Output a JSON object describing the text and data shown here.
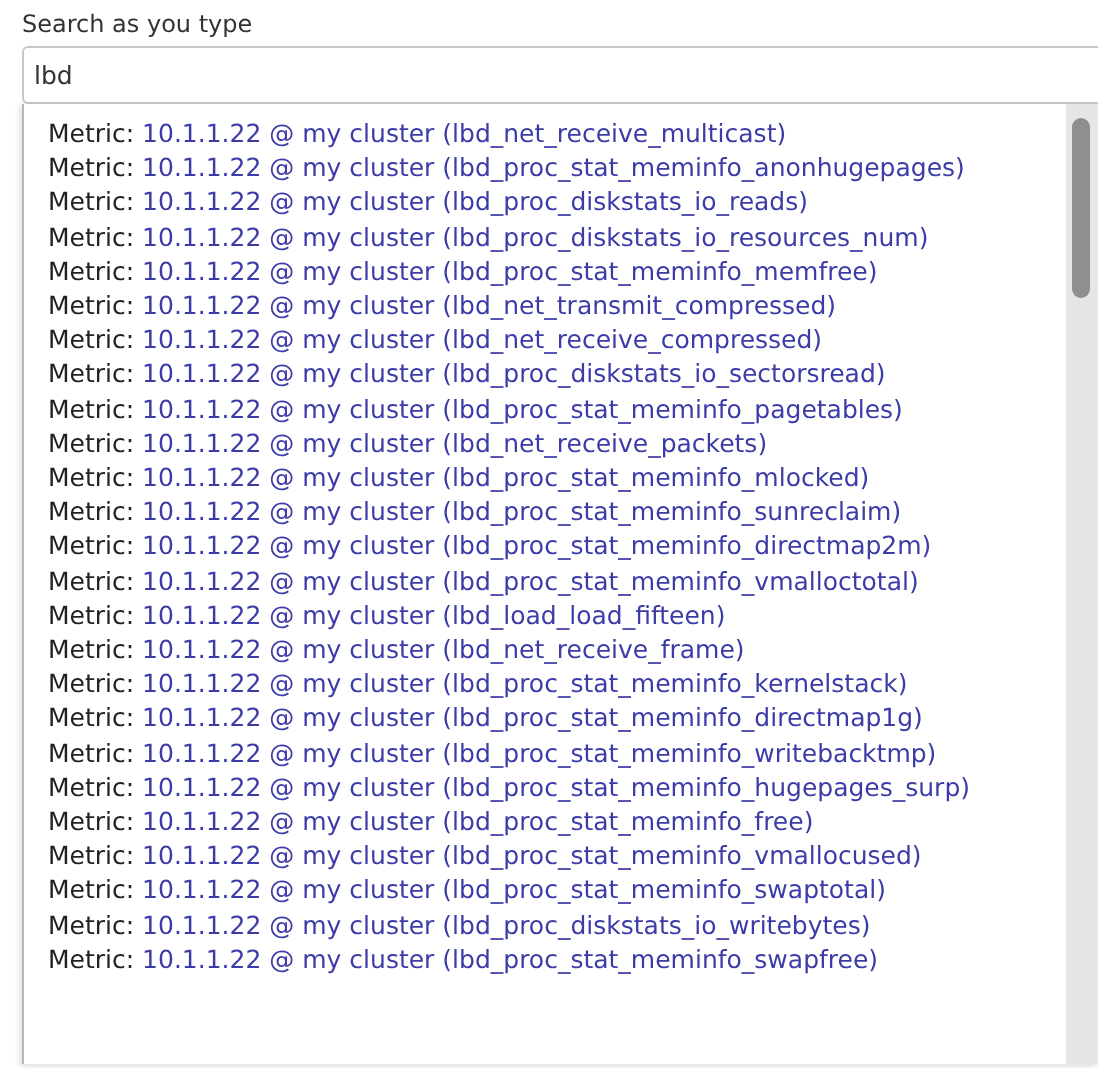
{
  "search": {
    "label": "Search as you type",
    "value": "lbd"
  },
  "suggestions": [
    {
      "label": "Metric:",
      "value": "10.1.1.22 @ my cluster (lbd_net_receive_multicast)"
    },
    {
      "label": "Metric:",
      "value": "10.1.1.22 @ my cluster (lbd_proc_stat_meminfo_anonhugepages)"
    },
    {
      "label": "Metric:",
      "value": "10.1.1.22 @ my cluster (lbd_proc_diskstats_io_reads)"
    },
    {
      "label": "Metric:",
      "value": "10.1.1.22 @ my cluster (lbd_proc_diskstats_io_resources_num)"
    },
    {
      "label": "Metric:",
      "value": "10.1.1.22 @ my cluster (lbd_proc_stat_meminfo_memfree)"
    },
    {
      "label": "Metric:",
      "value": "10.1.1.22 @ my cluster (lbd_net_transmit_compressed)"
    },
    {
      "label": "Metric:",
      "value": "10.1.1.22 @ my cluster (lbd_net_receive_compressed)"
    },
    {
      "label": "Metric:",
      "value": "10.1.1.22 @ my cluster (lbd_proc_diskstats_io_sectorsread)"
    },
    {
      "label": "Metric:",
      "value": "10.1.1.22 @ my cluster (lbd_proc_stat_meminfo_pagetables)"
    },
    {
      "label": "Metric:",
      "value": "10.1.1.22 @ my cluster (lbd_net_receive_packets)"
    },
    {
      "label": "Metric:",
      "value": "10.1.1.22 @ my cluster (lbd_proc_stat_meminfo_mlocked)"
    },
    {
      "label": "Metric:",
      "value": "10.1.1.22 @ my cluster (lbd_proc_stat_meminfo_sunreclaim)"
    },
    {
      "label": "Metric:",
      "value": "10.1.1.22 @ my cluster (lbd_proc_stat_meminfo_directmap2m)"
    },
    {
      "label": "Metric:",
      "value": "10.1.1.22 @ my cluster (lbd_proc_stat_meminfo_vmalloctotal)"
    },
    {
      "label": "Metric:",
      "value": "10.1.1.22 @ my cluster (lbd_load_load_fifteen)"
    },
    {
      "label": "Metric:",
      "value": "10.1.1.22 @ my cluster (lbd_net_receive_frame)"
    },
    {
      "label": "Metric:",
      "value": "10.1.1.22 @ my cluster (lbd_proc_stat_meminfo_kernelstack)"
    },
    {
      "label": "Metric:",
      "value": "10.1.1.22 @ my cluster (lbd_proc_stat_meminfo_directmap1g)"
    },
    {
      "label": "Metric:",
      "value": "10.1.1.22 @ my cluster (lbd_proc_stat_meminfo_writebacktmp)"
    },
    {
      "label": "Metric:",
      "value": "10.1.1.22 @ my cluster (lbd_proc_stat_meminfo_hugepages_surp)"
    },
    {
      "label": "Metric:",
      "value": "10.1.1.22 @ my cluster (lbd_proc_stat_meminfo_free)"
    },
    {
      "label": "Metric:",
      "value": "10.1.1.22 @ my cluster (lbd_proc_stat_meminfo_vmallocused)"
    },
    {
      "label": "Metric:",
      "value": "10.1.1.22 @ my cluster (lbd_proc_stat_meminfo_swaptotal)"
    },
    {
      "label": "Metric:",
      "value": "10.1.1.22 @ my cluster (lbd_proc_diskstats_io_writebytes)"
    },
    {
      "label": "Metric:",
      "value": "10.1.1.22 @ my cluster (lbd_proc_stat_meminfo_swapfree)"
    }
  ]
}
